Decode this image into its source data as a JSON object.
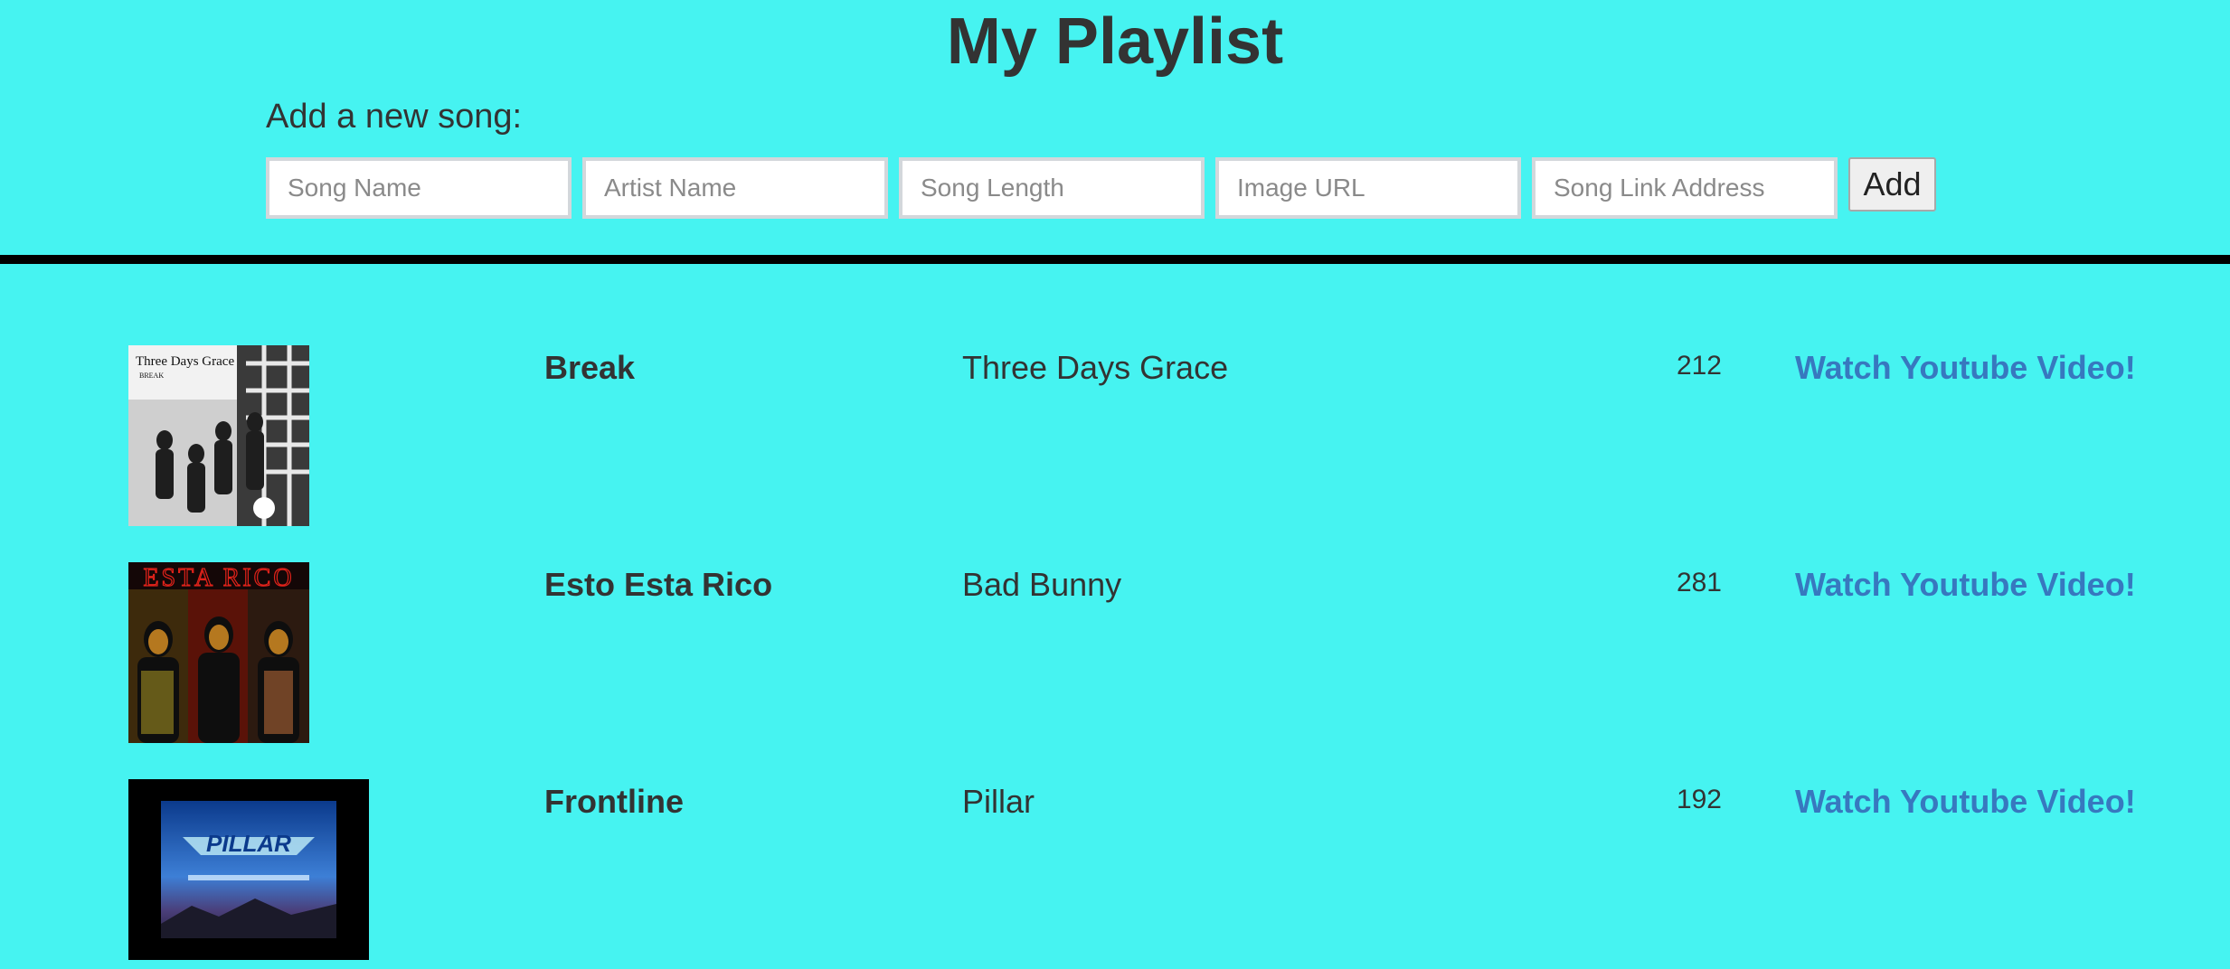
{
  "header": {
    "title": "My Playlist",
    "add_label": "Add a new song:"
  },
  "form": {
    "song_name": {
      "placeholder": "Song Name",
      "value": ""
    },
    "artist_name": {
      "placeholder": "Artist Name",
      "value": ""
    },
    "song_length": {
      "placeholder": "Song Length",
      "value": ""
    },
    "image_url": {
      "placeholder": "Image URL",
      "value": ""
    },
    "song_link": {
      "placeholder": "Song Link Address",
      "value": ""
    },
    "add_button": "Add"
  },
  "songs": [
    {
      "name": "Break",
      "artist": "Three Days Grace",
      "length": "212",
      "link_label": "Watch Youtube Video!",
      "cover_text": "Three Days Grace",
      "cover_subtext": "BREAK"
    },
    {
      "name": "Esto Esta Rico",
      "artist": "Bad Bunny",
      "length": "281",
      "link_label": "Watch Youtube Video!",
      "cover_text": "ESTA RICO"
    },
    {
      "name": "Frontline",
      "artist": "Pillar",
      "length": "192",
      "link_label": "Watch Youtube Video!",
      "cover_text": "PILLAR"
    }
  ],
  "colors": {
    "background": "#46f3f1",
    "link": "#3778bf",
    "divider": "#000000",
    "text": "#333333"
  }
}
